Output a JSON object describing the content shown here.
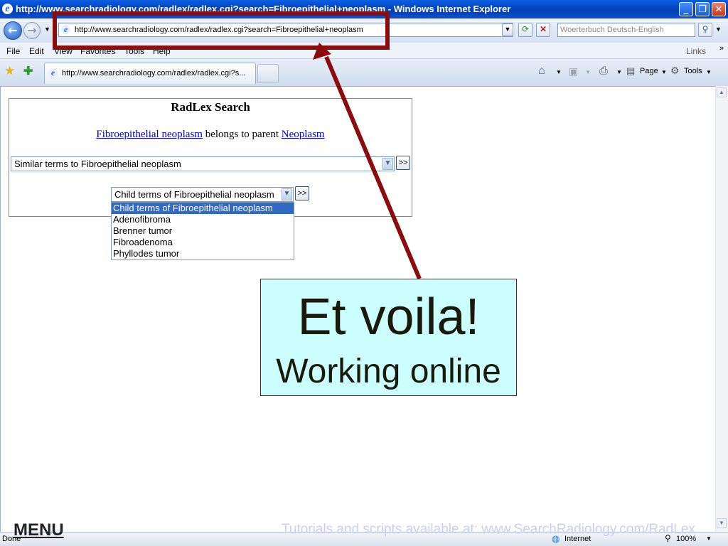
{
  "window": {
    "title": "http://www.searchradiology.com/radlex/radlex.cgi?search=Fibroepithelial+neoplasm - Windows Internet Explorer",
    "minimize": "_",
    "restore": "❐",
    "close": "✕"
  },
  "address_bar": {
    "url": "http://www.searchradiology.com/radlex/radlex.cgi?search=Fibroepithelial+neoplasm",
    "search_placeholder": "Woerterbuch Deutsch-English"
  },
  "menu": {
    "items": [
      "File",
      "Edit",
      "View",
      "Favorites",
      "Tools",
      "Help"
    ],
    "links": "Links"
  },
  "tab": {
    "title": "http://www.searchradiology.com/radlex/radlex.cgi?s..."
  },
  "command_bar": {
    "page": "Page",
    "tools": "Tools"
  },
  "radlex": {
    "title": "RadLex Search",
    "term": "Fibroepithelial neoplasm",
    "belongs_text": "belongs to parent",
    "parent": "Neoplasm",
    "similar_select": "Similar terms to Fibroepithelial neoplasm",
    "child_select": "Child terms of Fibroepithelial neoplasm",
    "go_label": ">>",
    "options": [
      "Child terms of Fibroepithelial neoplasm",
      "Adenofibroma",
      "Brenner tumor",
      "Fibroadenoma",
      "Phyllodes tumor"
    ]
  },
  "callout": {
    "title": "Et voila!",
    "subtitle": "Working online"
  },
  "status": {
    "left": "Done",
    "zone": "Internet",
    "zoom": "100%"
  },
  "overlay": {
    "menu": "MENU",
    "tutorial": "Tutorials and scripts available at: www.SearchRadiology.com/RadLex"
  },
  "colors": {
    "annotation": "#8b0c0c",
    "callout_bg": "#ccffff",
    "selection": "#316ac5"
  }
}
